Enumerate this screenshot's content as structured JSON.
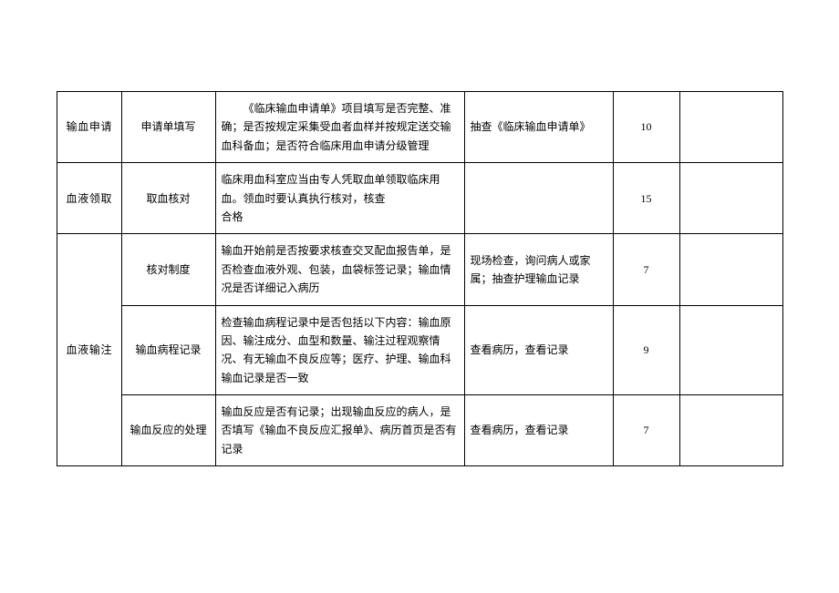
{
  "rows": [
    {
      "category": "输血申请",
      "item": "申请单填写",
      "content_indent": "《临床输血申请单》项目填写是否完整、准确；是否按规定采集受血者血样并按规定送交输血科备血；是否符合临床用血申请分级管理",
      "method": "抽查《临床输血申请单》",
      "score": "10"
    },
    {
      "category": "血液领取",
      "item": "取血核对",
      "content": "临床用血科室应当由专人凭取血单领取临床用血。领血时要认真执行核对，核查\n合格",
      "method": "",
      "score": "15"
    },
    {
      "category": "血液输注",
      "rowspan": 3,
      "items": [
        {
          "item": "核对制度",
          "content": "输血开始前是否按要求核查交叉配血报告单，是否检查血液外观、包装，血袋标签记录；输血情况是否详细记入病历",
          "method": "现场检查，询问病人或家属；抽查护理输血记录",
          "score": "7"
        },
        {
          "item": "输血病程记录",
          "content": "检查输血病程记录中是否包括以下内容：输血原因、输注成分、血型和数量、输注过程观察情况、有无输血不良反应等；医疗、护理、输血科输血记录是否一致",
          "method": "查看病历，查看记录",
          "score": "9"
        },
        {
          "item": "输血反应的处理",
          "content": "输血反应是否有记录；出现输血反应的病人，是否填写《输血不良反应汇报单》、病历首页是否有记录",
          "method": "查看病历，查看记录",
          "score": "7"
        }
      ]
    }
  ]
}
